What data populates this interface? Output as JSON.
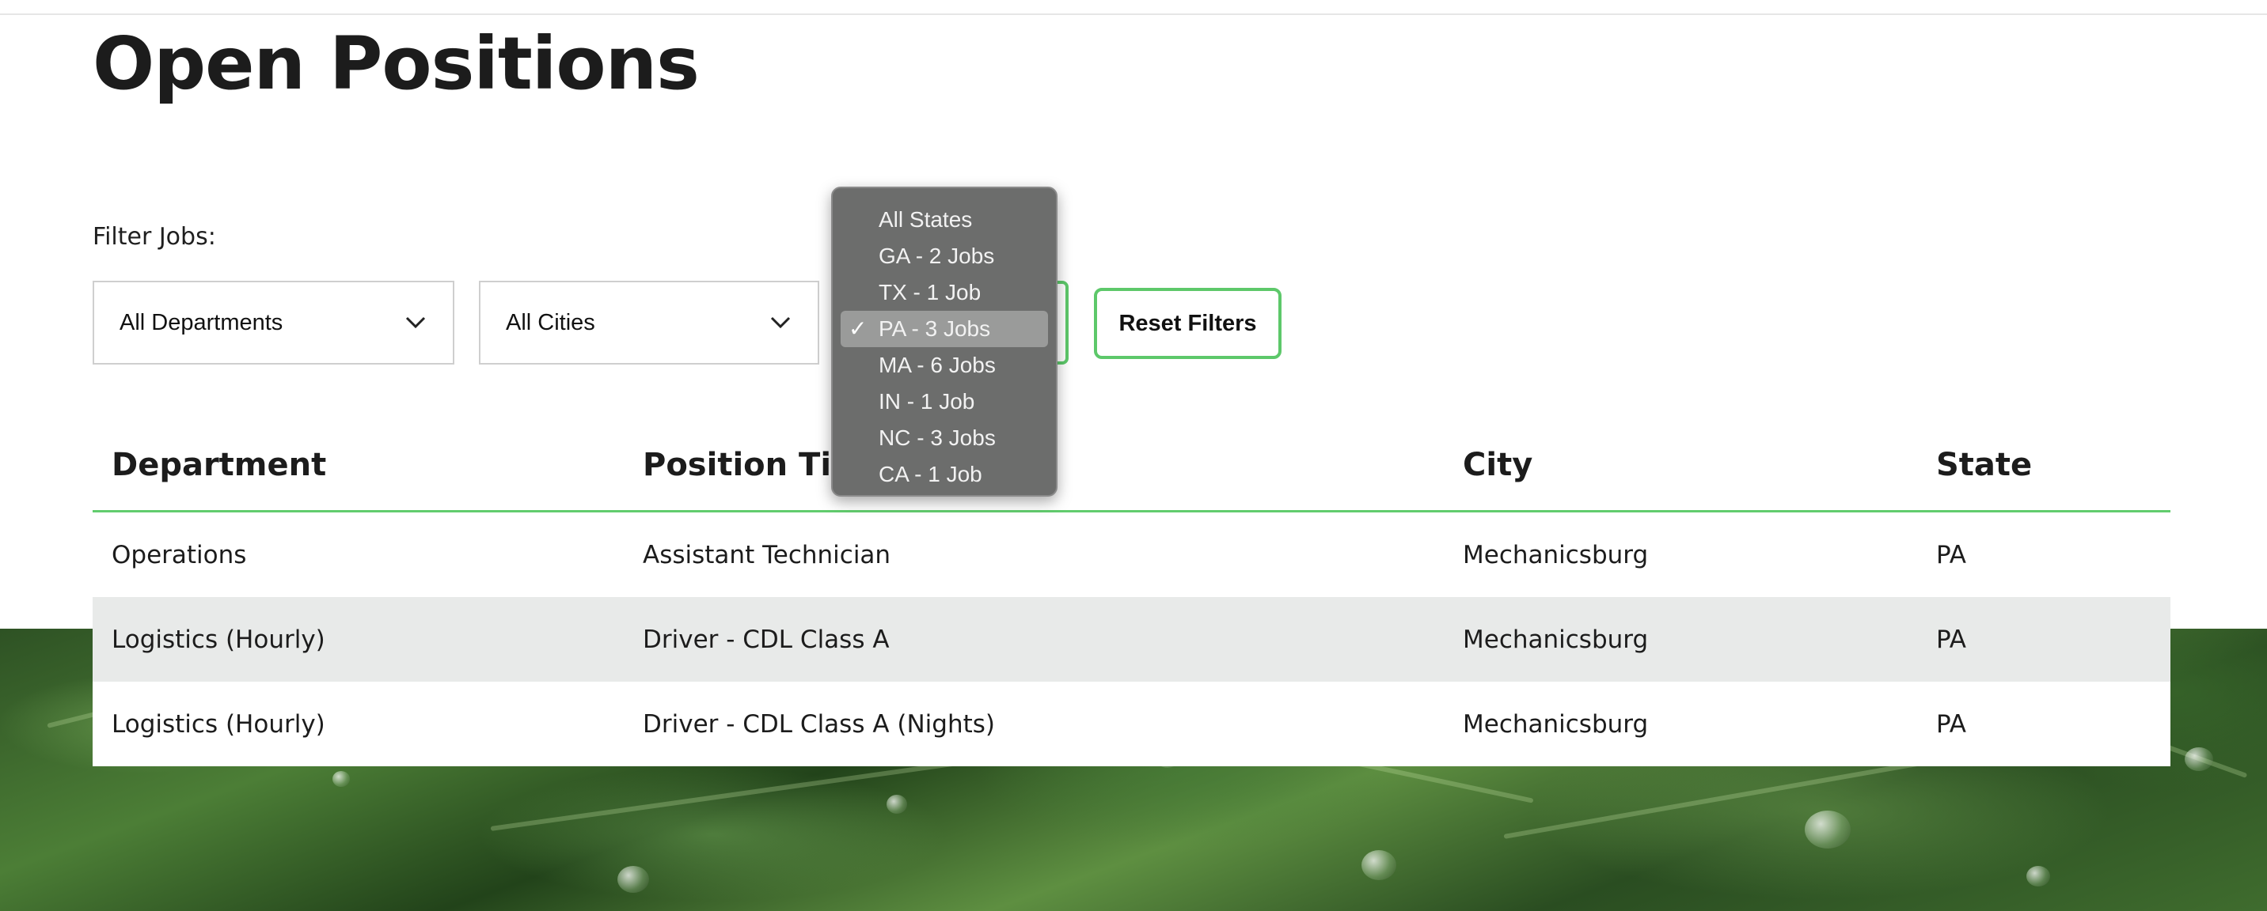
{
  "page": {
    "title": "Open Positions"
  },
  "filters": {
    "label": "Filter Jobs:",
    "department": {
      "value": "All Departments",
      "icon": "chevron-down-icon"
    },
    "city": {
      "value": "All Cities",
      "icon": "chevron-down-icon"
    },
    "reset_label": "Reset Filters",
    "state_dropdown": {
      "selected": "PA - 3 Jobs",
      "options": [
        "All States",
        "GA - 2 Jobs",
        "TX - 1 Job",
        "PA - 3 Jobs",
        "MA - 6 Jobs",
        "IN - 1 Job",
        "NC - 3 Jobs",
        "CA - 1 Job"
      ],
      "check_glyph": "✓"
    }
  },
  "table": {
    "headers": [
      "Department",
      "Position Title",
      "City",
      "State"
    ],
    "rows": [
      [
        "Operations",
        "Assistant Technician",
        "Mechanicsburg",
        "PA"
      ],
      [
        "Logistics (Hourly)",
        "Driver - CDL Class A",
        "Mechanicsburg",
        "PA"
      ],
      [
        "Logistics (Hourly)",
        "Driver - CDL Class A (Nights)",
        "Mechanicsburg",
        "PA"
      ]
    ]
  },
  "colors": {
    "accent": "#5dc86a",
    "stripe": "#e8eae9",
    "dropdown_bg": "#6c6d6c",
    "dropdown_selected": "#9a9b9a"
  }
}
